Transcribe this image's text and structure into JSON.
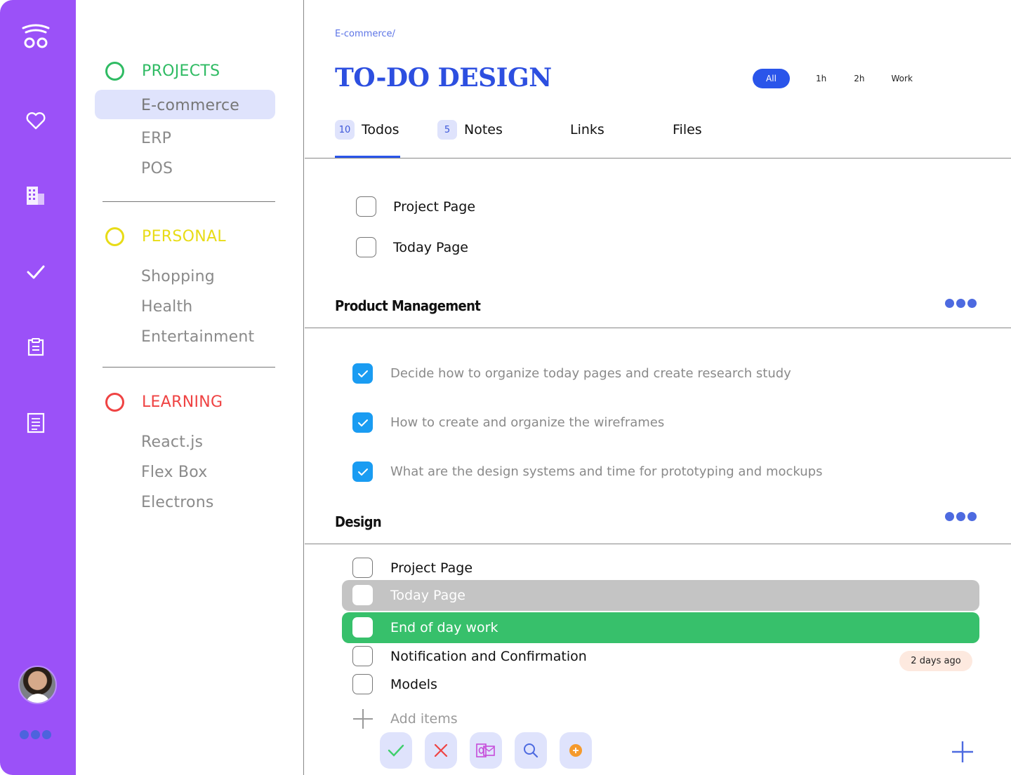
{
  "rail": {
    "icons": [
      "app-logo-icon",
      "heart-icon",
      "buildings-icon",
      "check-icon",
      "clipboard-icon",
      "document-icon"
    ],
    "accent": "#9b51f8"
  },
  "sidebar": {
    "groups": [
      {
        "title": "PROJECTS",
        "color": "#2fbb63",
        "items": [
          "E-commerce",
          "ERP",
          "POS"
        ],
        "active": "E-commerce"
      },
      {
        "title": "PERSONAL",
        "color": "#e8dc17",
        "items": [
          "Shopping",
          "Health",
          "Entertainment"
        ]
      },
      {
        "title": "LEARNING",
        "color": "#ef4343",
        "items": [
          "React.js",
          "Flex Box",
          "Electrons"
        ]
      }
    ]
  },
  "main": {
    "breadcrumb": "E-commerce/",
    "title": "TO-DO DESIGN",
    "filters": [
      "All",
      "1h",
      "2h",
      "Work"
    ],
    "active_filter": "All",
    "tabs": [
      {
        "label": "Todos",
        "count": "10"
      },
      {
        "label": "Notes",
        "count": "5"
      },
      {
        "label": "Links"
      },
      {
        "label": "Files"
      }
    ],
    "top_tasks": [
      "Project Page",
      "Today Page"
    ],
    "sections": [
      {
        "title": "Product Management",
        "tasks": [
          {
            "text": "Decide how to organize today pages and create research study",
            "done": true
          },
          {
            "text": "How to create and organize the wireframes",
            "done": true
          },
          {
            "text": "What are the design systems and time for prototyping and mockups",
            "done": true
          }
        ]
      },
      {
        "title": "Design",
        "tasks": [
          {
            "text": "Project Page",
            "done": false
          },
          {
            "text": "Today Page",
            "done": false,
            "highlight": "grey"
          },
          {
            "text": "End of day work",
            "done": false,
            "highlight": "green"
          },
          {
            "text": "Notification and Confirmation",
            "done": false,
            "badge": "2 days ago"
          },
          {
            "text": "Models",
            "done": false
          }
        ]
      }
    ],
    "add_placeholder": "Add items",
    "toolbar_icons": [
      "check-icon",
      "close-icon",
      "outlook-icon",
      "search-icon",
      "add-circle-icon",
      "plus-icon"
    ]
  }
}
